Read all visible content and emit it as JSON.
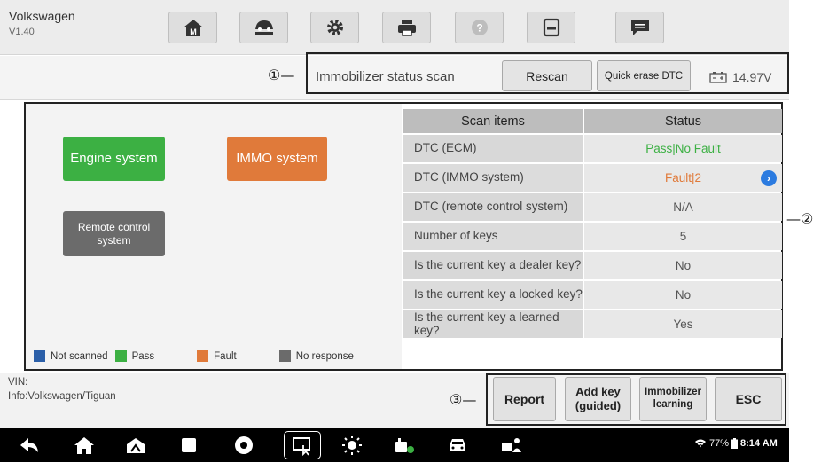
{
  "app": {
    "name": "Volkswagen",
    "version": "V1.40"
  },
  "toolbar": {
    "icons": [
      "home-icon",
      "vehicle-lift-icon",
      "settings-gear-icon",
      "printer-icon",
      "help-icon",
      "save-icon",
      "message-icon"
    ]
  },
  "status": {
    "title": "Immobilizer status scan",
    "rescan_label": "Rescan",
    "quick_erase_label": "Quick erase DTC",
    "voltage": "14.97V"
  },
  "callouts": {
    "one": "①",
    "two": "②",
    "three": "③"
  },
  "systems": {
    "engine": "Engine system",
    "immo": "IMMO system",
    "remote": "Remote control system"
  },
  "legend": {
    "not_scanned": "Not scanned",
    "pass": "Pass",
    "fault": "Fault",
    "no_response": "No response"
  },
  "table": {
    "headers": [
      "Scan items",
      "Status"
    ],
    "rows": [
      {
        "item": "DTC (ECM)",
        "status": "Pass|No Fault"
      },
      {
        "item": "DTC (IMMO system)",
        "status": "Fault|2"
      },
      {
        "item": "DTC (remote control system)",
        "status": "N/A"
      },
      {
        "item": "Number of keys",
        "status": "5"
      },
      {
        "item": "Is the current key a dealer key?",
        "status": "No"
      },
      {
        "item": "Is the current key a locked key?",
        "status": "No"
      },
      {
        "item": "Is the current key a learned key?",
        "status": "Yes"
      }
    ]
  },
  "info": {
    "vin": "VIN:",
    "info": "Info:Volkswagen/Tiguan"
  },
  "actions": {
    "report": "Report",
    "add_key": "Add key (guided)",
    "immo_learning": "Immobilizer learning",
    "esc": "ESC"
  },
  "system_status": {
    "battery": "77%",
    "time": "8:14 AM"
  },
  "colors": {
    "pass": "#3cb043",
    "fault": "#e07a3a",
    "no_response": "#6b6b6b",
    "not_scanned": "#2b5fa8"
  }
}
